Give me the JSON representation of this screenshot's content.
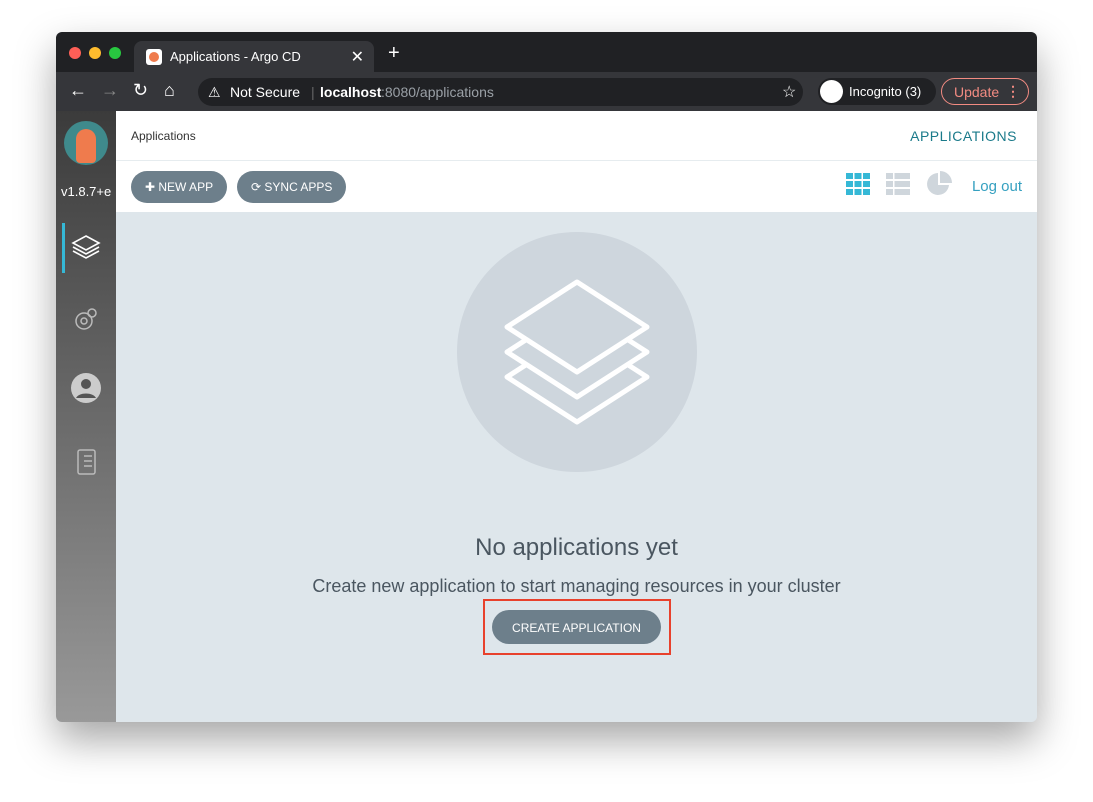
{
  "browser": {
    "tab_title": "Applications - Argo CD",
    "security": "Not Secure",
    "url_host": "localhost",
    "url_rest": ":8080/applications",
    "incognito": "Incognito (3)",
    "update": "Update"
  },
  "sidebar": {
    "version": "v1.8.7+e",
    "items": [
      "applications",
      "settings",
      "user-info",
      "docs"
    ]
  },
  "header": {
    "breadcrumb": "Applications",
    "title": "APPLICATIONS"
  },
  "toolbar": {
    "new_app": "NEW APP",
    "sync_apps": "SYNC APPS",
    "logout": "Log out"
  },
  "empty": {
    "title": "No applications yet",
    "subtitle": "Create new application to start managing resources in your cluster",
    "button": "CREATE APPLICATION"
  },
  "colors": {
    "accent": "#1a7a8a",
    "active_view": "#35b8d6",
    "button": "#6d7f8b",
    "highlight": "#e8412c"
  }
}
